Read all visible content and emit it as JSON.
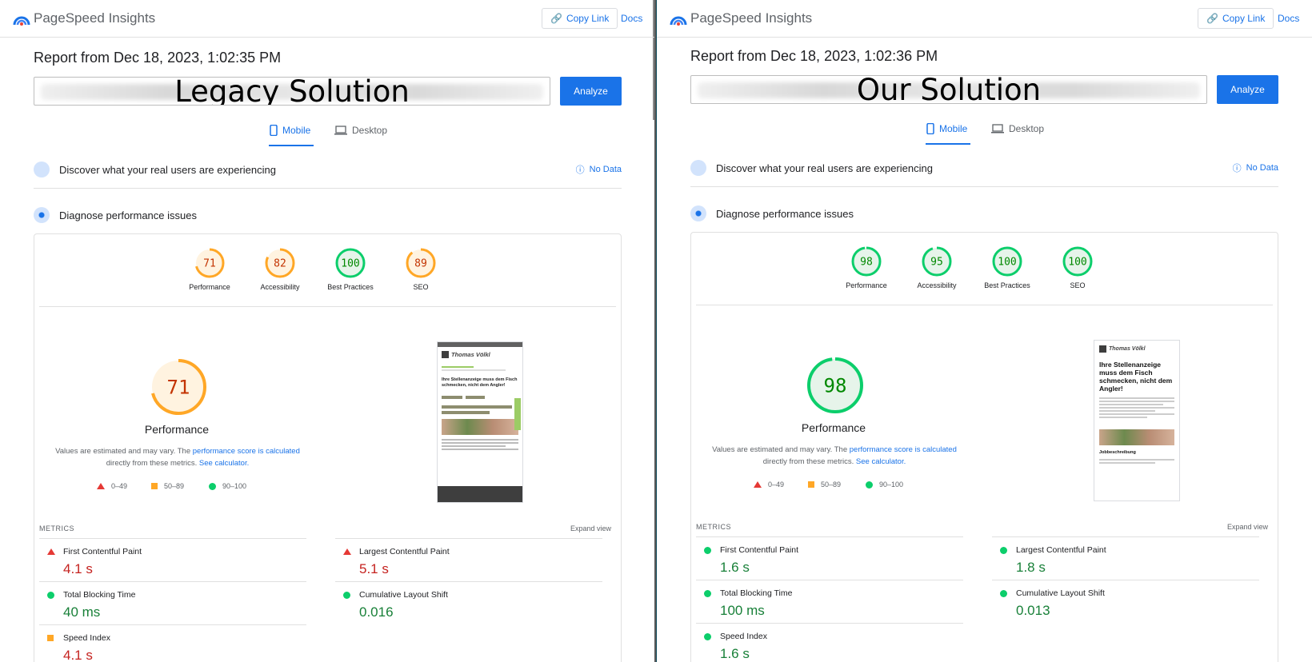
{
  "colors": {
    "accent": "#1a73e8",
    "fail": "#e53935",
    "average": "#ffa726",
    "pass": "#0cce6b"
  },
  "panels": [
    {
      "app_title": "PageSpeed Insights",
      "copy_link": "Copy Link",
      "docs": "Docs",
      "report_from": "Report from Dec 18, 2023, 1:02:35 PM",
      "url_overlay": "Legacy Solution",
      "analyze": "Analyze",
      "tabs": {
        "mobile": "Mobile",
        "desktop": "Desktop"
      },
      "discover": "Discover what your real users are experiencing",
      "no_data": "No Data",
      "diagnose": "Diagnose performance issues",
      "gauges": [
        {
          "label": "Performance",
          "score": "71",
          "status": "average"
        },
        {
          "label": "Accessibility",
          "score": "82",
          "status": "average"
        },
        {
          "label": "Best Practices",
          "score": "100",
          "status": "pass"
        },
        {
          "label": "SEO",
          "score": "89",
          "status": "average"
        }
      ],
      "main_score": "71",
      "main_status": "average",
      "main_label": "Performance",
      "note_prefix": "Values are estimated and may vary. The ",
      "note_link1": "performance score is calculated",
      "note_mid": "directly from these metrics. ",
      "note_link2": "See calculator.",
      "legend": {
        "fail": "0–49",
        "average": "50–89",
        "pass": "90–100"
      },
      "metrics_header": "METRICS",
      "expand_view": "Expand view",
      "metrics": [
        {
          "name": "First Contentful Paint",
          "value": "4.1 s",
          "status": "fail"
        },
        {
          "name": "Largest Contentful Paint",
          "value": "5.1 s",
          "status": "fail"
        },
        {
          "name": "Total Blocking Time",
          "value": "40 ms",
          "status": "pass"
        },
        {
          "name": "Cumulative Layout Shift",
          "value": "0.016",
          "status": "pass"
        },
        {
          "name": "Speed Index",
          "value": "4.1 s",
          "status": "average"
        }
      ],
      "thumbnail": {
        "brand": "Thomas Völkl",
        "headline": "Ihre Stellenanzeige muss dem Fisch schmecken, nicht dem Angler!"
      }
    },
    {
      "app_title": "PageSpeed Insights",
      "copy_link": "Copy Link",
      "docs": "Docs",
      "report_from": "Report from Dec 18, 2023, 1:02:36 PM",
      "url_overlay": "Our Solution",
      "analyze": "Analyze",
      "tabs": {
        "mobile": "Mobile",
        "desktop": "Desktop"
      },
      "discover": "Discover what your real users are experiencing",
      "no_data": "No Data",
      "diagnose": "Diagnose performance issues",
      "gauges": [
        {
          "label": "Performance",
          "score": "98",
          "status": "pass"
        },
        {
          "label": "Accessibility",
          "score": "95",
          "status": "pass"
        },
        {
          "label": "Best Practices",
          "score": "100",
          "status": "pass"
        },
        {
          "label": "SEO",
          "score": "100",
          "status": "pass"
        }
      ],
      "main_score": "98",
      "main_status": "pass",
      "main_label": "Performance",
      "note_prefix": "Values are estimated and may vary. The ",
      "note_link1": "performance score is calculated",
      "note_mid": "directly from these metrics. ",
      "note_link2": "See calculator.",
      "legend": {
        "fail": "0–49",
        "average": "50–89",
        "pass": "90–100"
      },
      "metrics_header": "METRICS",
      "expand_view": "Expand view",
      "metrics": [
        {
          "name": "First Contentful Paint",
          "value": "1.6 s",
          "status": "pass"
        },
        {
          "name": "Largest Contentful Paint",
          "value": "1.8 s",
          "status": "pass"
        },
        {
          "name": "Total Blocking Time",
          "value": "100 ms",
          "status": "pass"
        },
        {
          "name": "Cumulative Layout Shift",
          "value": "0.013",
          "status": "pass"
        },
        {
          "name": "Speed Index",
          "value": "1.6 s",
          "status": "pass"
        }
      ],
      "thumbnail": {
        "brand": "Thomas Völkl",
        "headline": "Ihre Stellenanzeige muss dem Fisch schmecken, nicht dem Angler!",
        "section": "Jobbeschreibung"
      }
    }
  ]
}
